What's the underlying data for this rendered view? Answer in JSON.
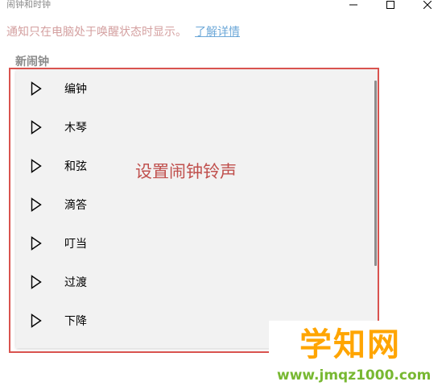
{
  "window": {
    "title": "闹钟和时钟",
    "controls": [
      "minimize-icon",
      "maximize-icon",
      "close-icon"
    ]
  },
  "notice": {
    "text": "通知只在电脑处于唤醒状态时显示。",
    "link": "了解详情"
  },
  "section": {
    "label": "新闹钟"
  },
  "tones": [
    {
      "label": "编钟",
      "icon": "play-icon"
    },
    {
      "label": "木琴",
      "icon": "play-icon"
    },
    {
      "label": "和弦",
      "icon": "play-icon"
    },
    {
      "label": "滴答",
      "icon": "play-icon"
    },
    {
      "label": "叮当",
      "icon": "play-icon"
    },
    {
      "label": "过渡",
      "icon": "play-icon"
    },
    {
      "label": "下降",
      "icon": "play-icon"
    }
  ],
  "annotation": {
    "text": "设置闹钟铃声",
    "color": "#c0504d"
  },
  "watermark": {
    "brand": "学知网",
    "url": "www.jmqz1000.com"
  },
  "colors": {
    "frame": "#d9534f",
    "panel": "#f2f2f2",
    "link": "#6da8d8",
    "watermark_brand": "#ffa500",
    "watermark_url": "#78b832"
  }
}
